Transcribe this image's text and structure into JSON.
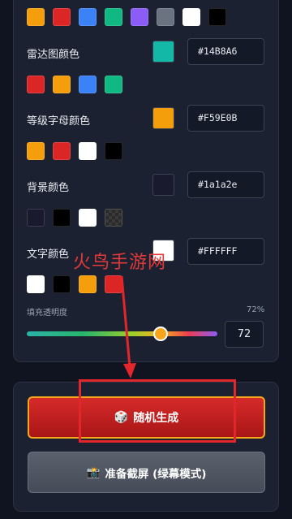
{
  "top_swatches": [
    "#F59E0B",
    "#DC2626",
    "#3B82F6",
    "#10B981",
    "#8B5CF6",
    "#6B7280",
    "#FFFFFF",
    "#000000"
  ],
  "radar": {
    "label": "雷达图颜色",
    "value": "#14B8A6",
    "pick_color": "#14B8A6",
    "presets": [
      "#DC2626",
      "#F59E0B",
      "#3B82F6",
      "#10B981"
    ]
  },
  "grade": {
    "label": "等级字母颜色",
    "value": "#F59E0B",
    "pick_color": "#F59E0B",
    "presets": [
      "#F59E0B",
      "#DC2626",
      "#FFFFFF",
      "#000000"
    ]
  },
  "background": {
    "label": "背景颜色",
    "value": "#1a1a2e",
    "pick_color": "#1a1a2e",
    "presets": [
      "#1a1a2e",
      "#000000",
      "#FFFFFF",
      "#333333"
    ]
  },
  "text": {
    "label": "文字颜色",
    "value": "#FFFFFF",
    "pick_color": "#FFFFFF",
    "presets": [
      "#FFFFFF",
      "#000000",
      "#F59E0B",
      "#DC2626"
    ]
  },
  "opacity": {
    "label": "填充透明度",
    "percent_label": "72%",
    "value": "72",
    "level": 0.72
  },
  "buttons": {
    "random_icon": "🎲",
    "random_label": "随机生成",
    "screenshot_icon": "📸",
    "screenshot_label": "准备截屏 (绿幕模式)"
  },
  "watermark": "火鸟手游网",
  "colors": {
    "annotation": "#e3262b"
  }
}
